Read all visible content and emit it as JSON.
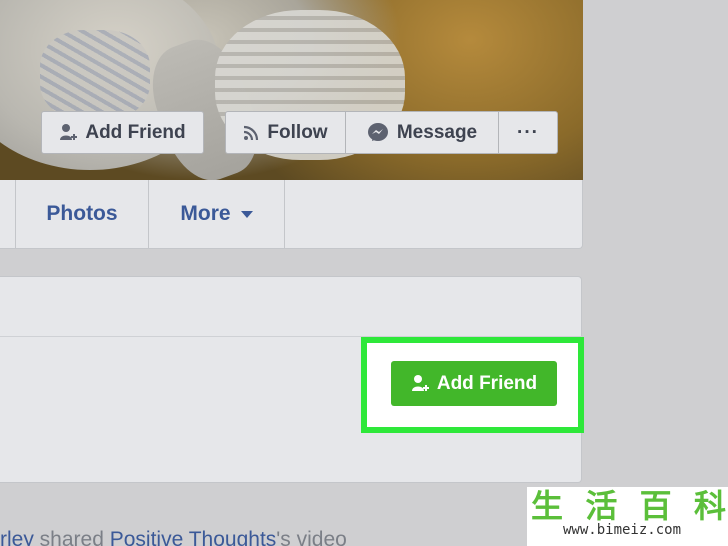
{
  "cover": {
    "add_friend_label": "Add Friend",
    "follow_label": "Follow",
    "message_label": "Message",
    "more_label": "···"
  },
  "tabs": {
    "photos": "Photos",
    "more": "More"
  },
  "card": {
    "add_friend_label": "Add Friend"
  },
  "feed": {
    "author_fragment": "rley",
    "action": " shared ",
    "page": "Positive Thoughts",
    "suffix": "'s video"
  },
  "watermark": {
    "chars": [
      "生",
      "活",
      "百",
      "科"
    ],
    "url": "www.bimeiz.com"
  },
  "colors": {
    "link_blue": "#3b5998",
    "button_green": "#42b72a",
    "highlight_green": "#2ee83a"
  },
  "icons": {
    "add_friend": "person-plus-icon",
    "follow": "rss-icon",
    "message": "messenger-icon",
    "more": "ellipsis-icon",
    "dropdown": "caret-down-icon"
  }
}
